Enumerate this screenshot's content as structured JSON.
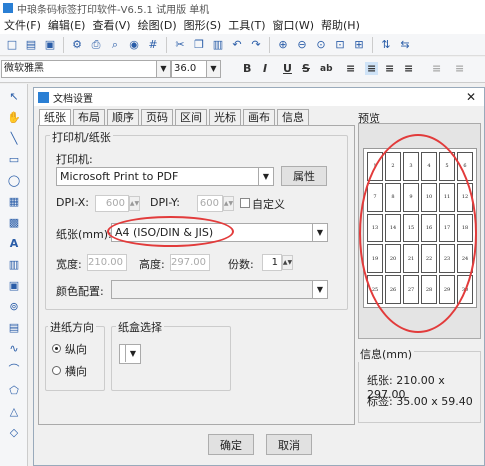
{
  "app": {
    "title": "中琅条码标签打印软件-V6.5.1 试用版 单机"
  },
  "menu": [
    "文件(F)",
    "编辑(E)",
    "查看(V)",
    "绘图(D)",
    "图形(S)",
    "工具(T)",
    "窗口(W)",
    "帮助(H)"
  ],
  "toolbar": {
    "font_name": "微软雅黑",
    "font_size": "36.0",
    "bold": "B",
    "italic": "I",
    "underline": "U",
    "strike": "S"
  },
  "dialog": {
    "title": "文档设置",
    "tabs": [
      "纸张",
      "布局",
      "顺序",
      "页码",
      "区间",
      "光标",
      "画布",
      "信息"
    ],
    "active_tab": "纸张",
    "printer_group": "打印机/纸张",
    "printer_label": "打印机:",
    "printer_value": "Microsoft Print to PDF",
    "properties_button": "属性",
    "dpix_label": "DPI-X:",
    "dpix_value": "600",
    "dpiy_label": "DPI-Y:",
    "dpiy_value": "600",
    "custom_label": "自定义",
    "paper_label": "纸张(mm):",
    "paper_value": "A4 (ISO/DIN & JIS)",
    "width_label": "宽度:",
    "width_value": "210.00",
    "height_label": "高度:",
    "height_value": "297.00",
    "copies_label": "份数:",
    "copies_value": "1",
    "color_label": "颜色配置:",
    "color_value": "",
    "feed_group": "进纸方向",
    "portrait": "纵向",
    "landscape": "横向",
    "tray_group": "纸盒选择",
    "preview_label": "预览",
    "preview_cells": [
      "1",
      "2",
      "3",
      "4",
      "5",
      "6",
      "7",
      "8",
      "9",
      "10",
      "11",
      "12",
      "13",
      "14",
      "15",
      "16",
      "17",
      "18",
      "19",
      "20",
      "21",
      "22",
      "23",
      "24",
      "25",
      "26",
      "27",
      "28",
      "29",
      "30"
    ],
    "info_label": "信息(mm)",
    "paper_info": "纸张: 210.00 x 297.00",
    "label_info": "标签: 35.00 x 59.40",
    "ok_button": "确定",
    "cancel_button": "取消"
  },
  "colors": {
    "annotation": "#e23b3b",
    "accent": "#2a7fd4"
  }
}
